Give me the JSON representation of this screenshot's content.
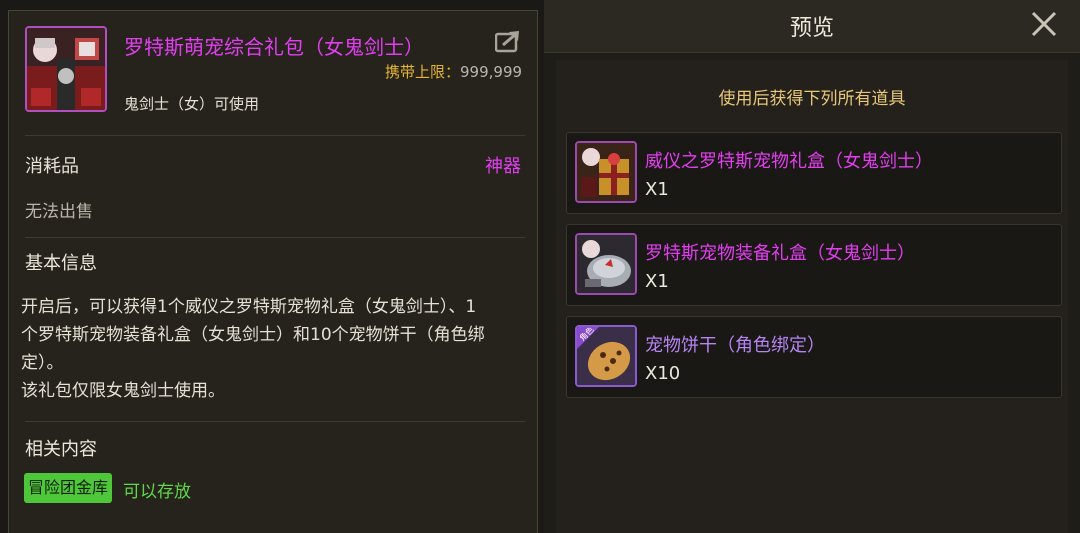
{
  "item": {
    "name": "罗特斯萌宠综合礼包（女鬼剑士）",
    "carry_limit_label": "携带上限：",
    "carry_limit_value": "999,999",
    "usable_by": "鬼剑士（女）可使用",
    "type": "消耗品",
    "rarity": "神器",
    "rarity_color": "#e23ef0",
    "sell": "无法出售",
    "basic_info_title": "基本信息",
    "description_lines": [
      "开启后，可以获得1个威仪之罗特斯宠物礼盒（女鬼剑士）、1",
      "个罗特斯宠物装备礼盒（女鬼剑士）和10个宠物饼干（角色绑",
      "定）。",
      "该礼包仅限女鬼剑士使用。"
    ],
    "related_title": "相关内容",
    "vault_badge": "冒险团金库",
    "vault_status": "可以存放",
    "share_icon": "share-icon"
  },
  "preview": {
    "title": "预览",
    "subtitle": "使用后获得下列所有道具",
    "close_icon": "close-icon",
    "rewards": [
      {
        "name": "威仪之罗特斯宠物礼盒（女鬼剑士）",
        "qty": "X1",
        "icon": "gift-box-icon"
      },
      {
        "name": "罗特斯宠物装备礼盒（女鬼剑士）",
        "qty": "X1",
        "icon": "pet-equipment-icon"
      },
      {
        "name": "宠物饼干（角色绑定）",
        "qty": "X10",
        "icon": "cookie-icon",
        "icon_tag": "角色"
      }
    ]
  }
}
